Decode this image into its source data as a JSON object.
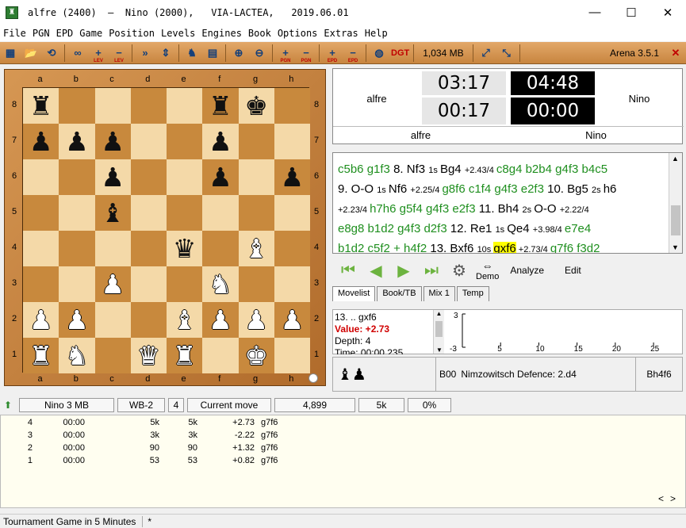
{
  "window": {
    "title": "alfre (2400)  –  Nino (2000),   VIA-LACTEA,   2019.06.01",
    "app_icon": "chess-board-icon",
    "minimize": "—",
    "maximize": "☐",
    "close": "✕"
  },
  "menu": [
    "File",
    "PGN",
    "EPD",
    "Game",
    "Position",
    "Levels",
    "Engines",
    "Book",
    "Options",
    "Extras",
    "Help"
  ],
  "toolbar": {
    "memory": "1,034 MB",
    "version": "Arena 3.5.1",
    "lev": "LEV",
    "pgn": "PGN",
    "epd": "EPD",
    "dgt": "DGT"
  },
  "board": {
    "files": [
      "a",
      "b",
      "c",
      "d",
      "e",
      "f",
      "g",
      "h"
    ],
    "ranks": [
      "8",
      "7",
      "6",
      "5",
      "4",
      "3",
      "2",
      "1"
    ],
    "position": [
      [
        "br",
        "",
        "",
        "",
        "",
        "br",
        "bk",
        ""
      ],
      [
        "bp",
        "bp",
        "bp",
        "",
        "",
        "bp",
        "",
        ""
      ],
      [
        "",
        "",
        "bp",
        "",
        "",
        "bp",
        "",
        "bp"
      ],
      [
        "",
        "",
        "bb",
        "",
        "",
        "",
        "",
        ""
      ],
      [
        "",
        "",
        "",
        "",
        "bq",
        "",
        "wb",
        ""
      ],
      [
        "",
        "",
        "wp",
        "",
        "",
        "wn",
        "",
        ""
      ],
      [
        "wp",
        "wp",
        "",
        "",
        "wb",
        "wp",
        "wp",
        "wp"
      ],
      [
        "wr",
        "wn",
        "",
        "wq",
        "wr",
        "",
        "wk",
        ""
      ]
    ]
  },
  "clocks": {
    "white_name": "alfre",
    "black_name": "Nino",
    "white_time": "03:17",
    "black_time": "04:48",
    "white_move_time": "00:17",
    "black_move_time": "00:00",
    "white_label": "alfre",
    "black_label": "Nino"
  },
  "notation": {
    "lines": [
      [
        {
          "t": "c5b6 ",
          "c": "g"
        },
        {
          "t": "g1f3 ",
          "c": "g"
        },
        {
          "t": "8. Nf3 ",
          "c": "m"
        },
        {
          "t": "1s ",
          "c": "s"
        },
        {
          "t": "Bg4 ",
          "c": "m"
        },
        {
          "t": "+2.43/4 ",
          "c": "s"
        },
        {
          "t": "c8g4 ",
          "c": "g"
        },
        {
          "t": "b2b4 ",
          "c": "g"
        },
        {
          "t": "g4f3 ",
          "c": "g"
        },
        {
          "t": "b4c5",
          "c": "g"
        }
      ],
      [
        {
          "t": "9. O-O ",
          "c": "m"
        },
        {
          "t": "1s ",
          "c": "s"
        },
        {
          "t": "Nf6 ",
          "c": "m"
        },
        {
          "t": "+2.25/4 ",
          "c": "s"
        },
        {
          "t": "g8f6 ",
          "c": "g"
        },
        {
          "t": "c1f4 ",
          "c": "g"
        },
        {
          "t": "g4f3 ",
          "c": "g"
        },
        {
          "t": "e2f3 ",
          "c": "g"
        },
        {
          "t": "10. Bg5 ",
          "c": "m"
        },
        {
          "t": "2s ",
          "c": "s"
        },
        {
          "t": "h6",
          "c": "m"
        }
      ],
      [
        {
          "t": "+2.23/4 ",
          "c": "s"
        },
        {
          "t": "h7h6 ",
          "c": "g"
        },
        {
          "t": "g5f4 ",
          "c": "g"
        },
        {
          "t": "g4f3 ",
          "c": "g"
        },
        {
          "t": "e2f3 ",
          "c": "g"
        },
        {
          "t": "11. Bh4 ",
          "c": "m"
        },
        {
          "t": "2s ",
          "c": "s"
        },
        {
          "t": "O-O ",
          "c": "m"
        },
        {
          "t": "+2.22/4",
          "c": "s"
        }
      ],
      [
        {
          "t": "e8g8 ",
          "c": "g"
        },
        {
          "t": "b1d2 ",
          "c": "g"
        },
        {
          "t": "g4f3 ",
          "c": "g"
        },
        {
          "t": "d2f3 ",
          "c": "g"
        },
        {
          "t": "12. Re1 ",
          "c": "m"
        },
        {
          "t": "1s ",
          "c": "s"
        },
        {
          "t": "Qe4 ",
          "c": "m"
        },
        {
          "t": "+3.98/4 ",
          "c": "s"
        },
        {
          "t": "e7e4",
          "c": "g"
        }
      ],
      [
        {
          "t": "b1d2 ",
          "c": "g"
        },
        {
          "t": "c5f2 + h4f2 ",
          "c": "g"
        },
        {
          "t": "13. Bxf6 ",
          "c": "m"
        },
        {
          "t": "10s ",
          "c": "s"
        },
        {
          "t": "gxf6",
          "c": "h"
        },
        {
          "t": " +2.73/4 ",
          "c": "s"
        },
        {
          "t": "g7f6 ",
          "c": "g"
        },
        {
          "t": "f3d2",
          "c": "g"
        }
      ]
    ]
  },
  "nav": {
    "demo": "Demo",
    "analyze": "Analyze",
    "edit": "Edit"
  },
  "tabs": [
    "Movelist",
    "Book/TB",
    "Mix 1",
    "Temp"
  ],
  "analysis": {
    "move": "13. .. gxf6",
    "value": "Value: +2.73",
    "depth": "Depth: 4",
    "time": "Time: 00:00.235",
    "y_top": "3",
    "y_bottom": "-3",
    "x_ticks": [
      "5",
      "10",
      "15",
      "20",
      "25"
    ]
  },
  "eco": {
    "code": "B00",
    "name": "Nimzowitsch Defence: 2.d4",
    "bestmove": "Bh4f6"
  },
  "engine_header": {
    "name": "Nino  3 MB",
    "protocol": "WB-2",
    "depth": "4",
    "current": "Current move",
    "nodes": "4,899",
    "nps": "5k",
    "percent": "0%"
  },
  "engine_lines": [
    {
      "depth": "4",
      "time": "00:00",
      "nodes": "5k",
      "nps": "5k",
      "score": "+2.73",
      "pv": "g7f6"
    },
    {
      "depth": "3",
      "time": "00:00",
      "nodes": "3k",
      "nps": "3k",
      "score": "-2.22",
      "pv": "g7f6"
    },
    {
      "depth": "2",
      "time": "00:00",
      "nodes": "90",
      "nps": "90",
      "score": "+1.32",
      "pv": "g7f6"
    },
    {
      "depth": "1",
      "time": "00:00",
      "nodes": "53",
      "nps": "53",
      "score": "+0.82",
      "pv": "g7f6"
    }
  ],
  "status": {
    "text": "Tournament Game in 5 Minutes",
    "modified": "*"
  }
}
